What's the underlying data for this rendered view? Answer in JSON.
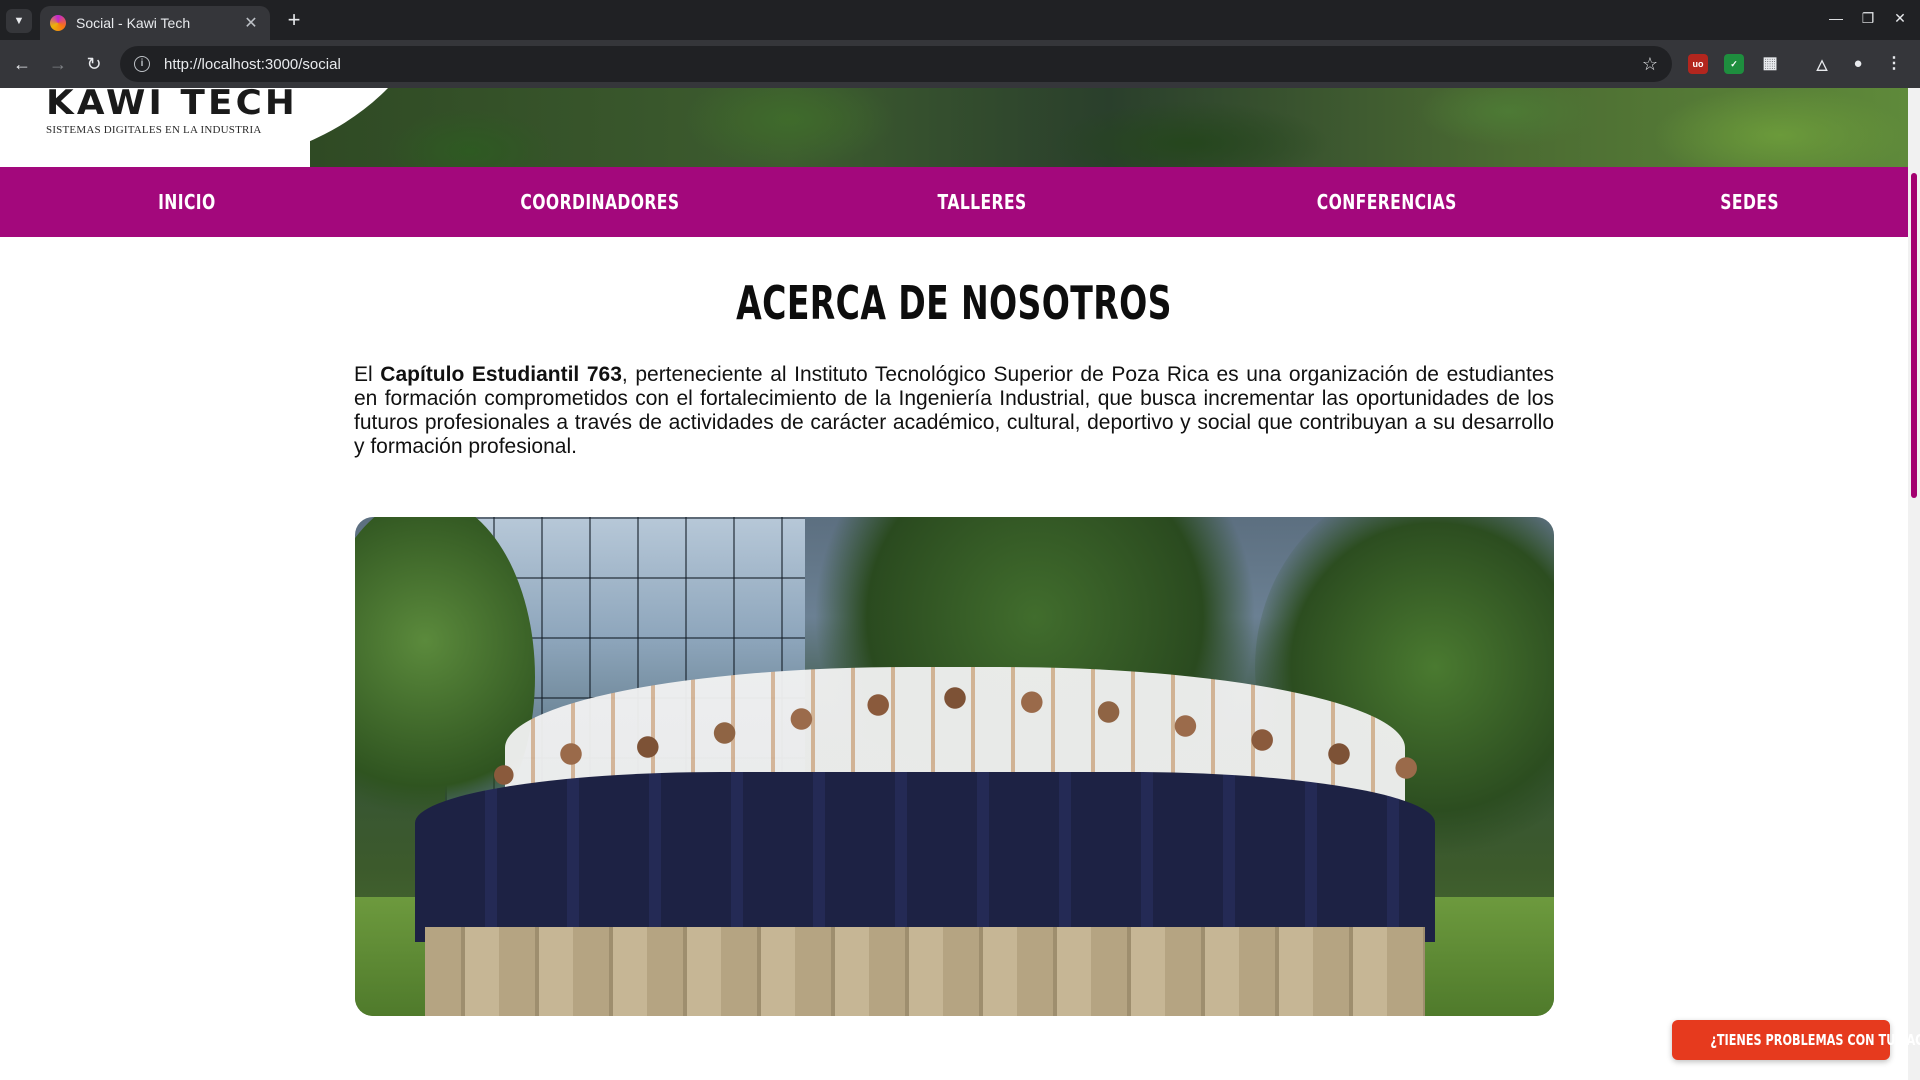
{
  "browser": {
    "tab_title": "Social - Kawi Tech",
    "url": "http://localhost:3000/social",
    "tab_list_icon": "chevron-down-icon",
    "new_tab_icon": "plus-icon",
    "extensions": [
      "ublock-icon",
      "shield-icon",
      "puzzle-icon",
      "labs-icon",
      "profile-icon",
      "menu-icon"
    ]
  },
  "header": {
    "logo_text": "KAWI TECH",
    "logo_subtitle": "SISTEMAS DIGITALES EN LA INDUSTRIA"
  },
  "nav": {
    "items": [
      {
        "label": "INICIO"
      },
      {
        "label": "COORDINADORES"
      },
      {
        "label": "TALLERES"
      },
      {
        "label": "CONFERENCIAS"
      },
      {
        "label": "SEDES"
      }
    ]
  },
  "main": {
    "title": "ACERCA DE NOSOTROS",
    "intro_prefix": "El ",
    "intro_bold": "Capítulo Estudiantil 763",
    "intro_rest": ", perteneciente al Instituto Tecnológico Superior de Poza Rica es una organización de estudiantes en formación comprometidos con el fortalecimiento de la Ingeniería Industrial, que busca incrementar las oportunidades de los futuros profesionales a través de actividades de carácter académico, cultural, deportivo y social que contribuyan a su desarrollo y formación profesional."
  },
  "help_button": {
    "label": "¿TIENES PROBLEMAS CON TU PAGO?"
  },
  "colors": {
    "nav_bg": "#a3087c",
    "help_button_bg": "#e63a1e",
    "chrome_dark": "#202124",
    "chrome_toolbar": "#35363a"
  }
}
